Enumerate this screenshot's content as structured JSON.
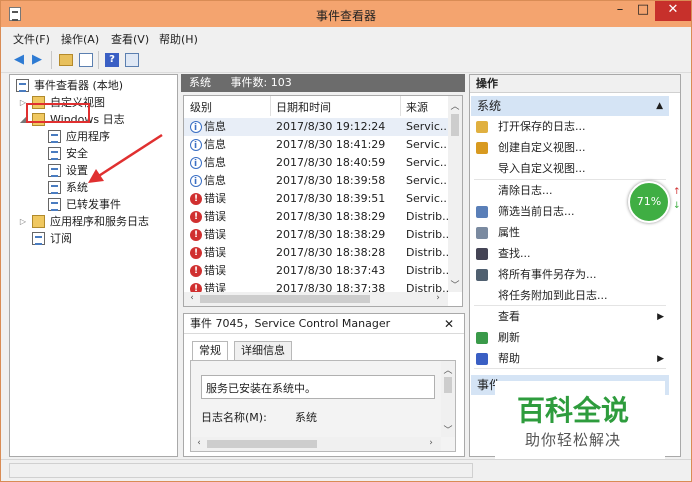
{
  "window": {
    "title": "事件查看器",
    "min": "–",
    "max": "□",
    "close": "✕"
  },
  "menu": [
    "文件(F)",
    "操作(A)",
    "查看(V)",
    "帮助(H)"
  ],
  "tree": {
    "root": "事件查看器 (本地)",
    "items": [
      {
        "label": "自定义视图",
        "exp": "▷"
      },
      {
        "label": "Windows 日志",
        "exp": "◢"
      },
      {
        "label": "应用程序",
        "exp": ""
      },
      {
        "label": "安全",
        "exp": ""
      },
      {
        "label": "设置",
        "exp": ""
      },
      {
        "label": "系统",
        "exp": ""
      },
      {
        "label": "已转发事件",
        "exp": ""
      },
      {
        "label": "应用程序和服务日志",
        "exp": "▷"
      },
      {
        "label": "订阅",
        "exp": ""
      }
    ]
  },
  "center": {
    "log_name": "系统",
    "count_label": "事件数: 103",
    "columns": [
      "级别",
      "日期和时间",
      "来源"
    ],
    "rows": [
      {
        "level": "信息",
        "type": "info",
        "date": "2017/8/30 19:12:24",
        "source": "Servic..."
      },
      {
        "level": "信息",
        "type": "info",
        "date": "2017/8/30 18:41:29",
        "source": "Servic..."
      },
      {
        "level": "信息",
        "type": "info",
        "date": "2017/8/30 18:40:59",
        "source": "Servic..."
      },
      {
        "level": "信息",
        "type": "info",
        "date": "2017/8/30 18:39:58",
        "source": "Servic..."
      },
      {
        "level": "错误",
        "type": "error",
        "date": "2017/8/30 18:39:51",
        "source": "Servic..."
      },
      {
        "level": "错误",
        "type": "error",
        "date": "2017/8/30 18:38:29",
        "source": "Distrib..."
      },
      {
        "level": "错误",
        "type": "error",
        "date": "2017/8/30 18:38:29",
        "source": "Distrib..."
      },
      {
        "level": "错误",
        "type": "error",
        "date": "2017/8/30 18:38:28",
        "source": "Distrib..."
      },
      {
        "level": "错误",
        "type": "error",
        "date": "2017/8/30 18:37:43",
        "source": "Distrib..."
      },
      {
        "level": "错误",
        "type": "error",
        "date": "2017/8/30 18:37:38",
        "source": "Distrib..."
      }
    ]
  },
  "detail": {
    "title": "事件 7045，Service Control Manager",
    "close": "✕",
    "tabs": [
      "常规",
      "详细信息"
    ],
    "message": "服务已安装在系统中。",
    "log_name_key": "日志名称(M):",
    "log_name_val": "系统"
  },
  "actions": {
    "header": "操作",
    "section": "系统",
    "items": [
      {
        "label": "打开保存的日志...",
        "icon": "folder-open-icon",
        "color": "#e0b040"
      },
      {
        "label": "创建自定义视图...",
        "icon": "filter-icon",
        "color": "#d89a20"
      },
      {
        "label": "导入自定义视图...",
        "icon": "",
        "color": ""
      },
      {
        "label": "清除日志...",
        "icon": "",
        "color": ""
      },
      {
        "label": "筛选当前日志...",
        "icon": "filter-icon",
        "color": "#5a7fb8"
      },
      {
        "label": "属性",
        "icon": "properties-icon",
        "color": "#7a8aa0"
      },
      {
        "label": "查找...",
        "icon": "binoculars-icon",
        "color": "#445"
      },
      {
        "label": "将所有事件另存为...",
        "icon": "save-icon",
        "color": "#506070"
      },
      {
        "label": "将任务附加到此日志...",
        "icon": "",
        "color": ""
      },
      {
        "label": "查看",
        "icon": "",
        "color": "",
        "sub": "▶"
      },
      {
        "label": "刷新",
        "icon": "refresh-icon",
        "color": "#3a9a4a"
      },
      {
        "label": "帮助",
        "icon": "help-icon",
        "color": "#3a5fc4",
        "sub": "▶"
      }
    ],
    "section2": "事件"
  },
  "gauge": {
    "value": "71%",
    "up": "↑",
    "down": "↓"
  },
  "watermark": {
    "title": "百科全说",
    "subtitle": "助你轻松解决"
  }
}
